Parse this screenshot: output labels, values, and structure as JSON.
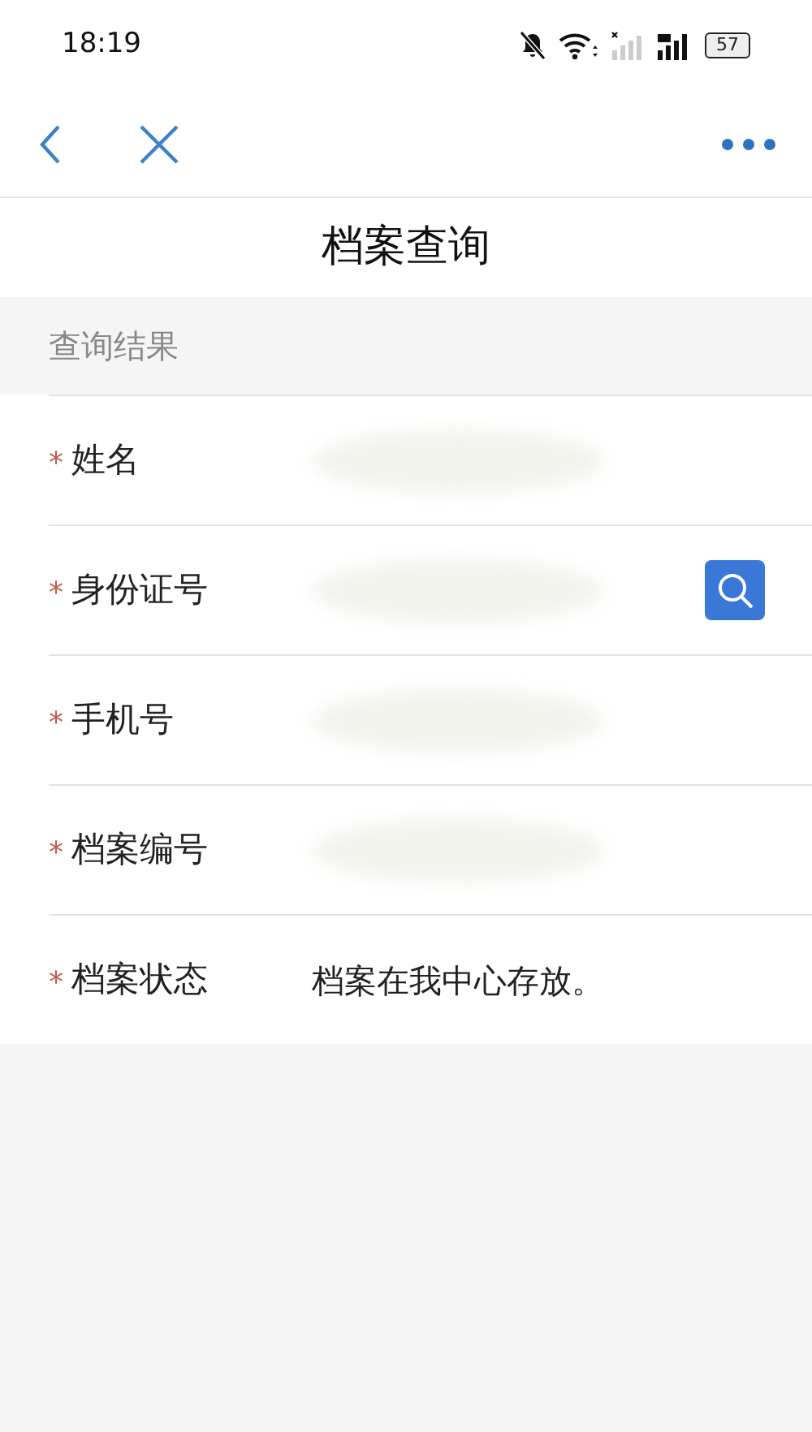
{
  "status_bar": {
    "time": "18:19",
    "battery": "57"
  },
  "title": "档案查询",
  "section_header": "查询结果",
  "rows": [
    {
      "mark": "*",
      "label": "姓名",
      "redacted": true,
      "kind": "plain"
    },
    {
      "mark": "*",
      "label": "身份证号",
      "redacted": true,
      "kind": "search"
    },
    {
      "mark": "*",
      "label": "手机号",
      "redacted": true,
      "kind": "plain"
    },
    {
      "mark": "*",
      "label": "档案编号",
      "redacted": true,
      "kind": "plain"
    },
    {
      "mark": "*",
      "label": "档案状态",
      "redacted": false,
      "kind": "plain",
      "value": "档案在我中心存放。"
    }
  ]
}
